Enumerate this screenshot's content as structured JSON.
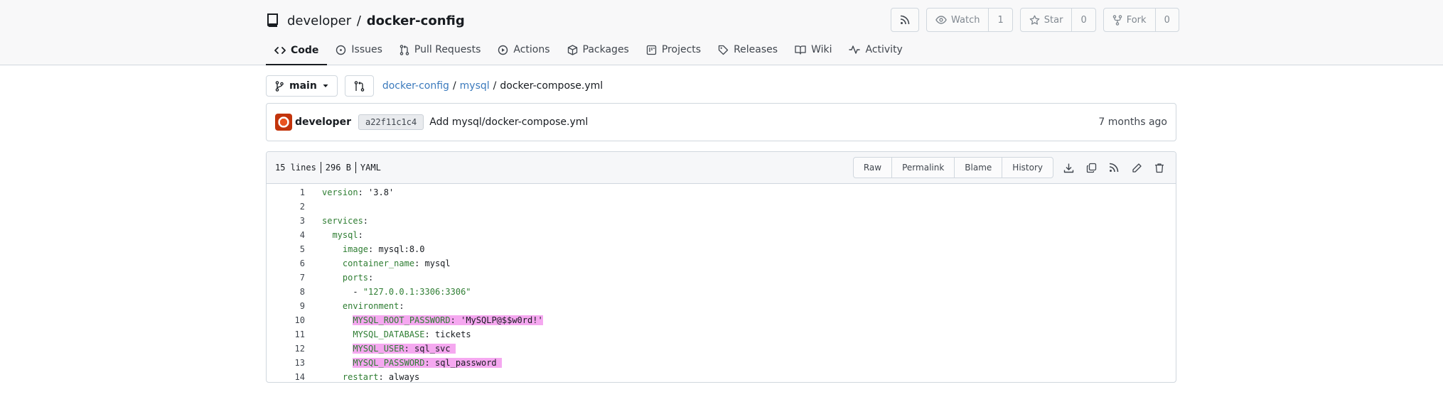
{
  "repo": {
    "owner": "developer",
    "separator": "/",
    "name": "docker-config"
  },
  "header_actions": {
    "rss_label": "",
    "watch": {
      "label": "Watch",
      "count": "1"
    },
    "star": {
      "label": "Star",
      "count": "0"
    },
    "fork": {
      "label": "Fork",
      "count": "0"
    }
  },
  "tabs": [
    {
      "label": "Code",
      "icon": "code-icon",
      "active": true
    },
    {
      "label": "Issues",
      "icon": "issue-icon"
    },
    {
      "label": "Pull Requests",
      "icon": "pull-request-icon"
    },
    {
      "label": "Actions",
      "icon": "play-icon"
    },
    {
      "label": "Packages",
      "icon": "package-icon"
    },
    {
      "label": "Projects",
      "icon": "project-icon"
    },
    {
      "label": "Releases",
      "icon": "tag-icon"
    },
    {
      "label": "Wiki",
      "icon": "book-icon"
    },
    {
      "label": "Activity",
      "icon": "pulse-icon"
    }
  ],
  "branch": {
    "name": "main"
  },
  "breadcrumb": {
    "root": "docker-config",
    "dir": "mysql",
    "file": "docker-compose.yml"
  },
  "commit": {
    "author": "developer",
    "sha": "a22f11c1c4",
    "message": "Add mysql/docker-compose.yml",
    "time": "7 months ago"
  },
  "file": {
    "lines": "15 lines",
    "size": "296 B",
    "type": "YAML",
    "actions": [
      "Raw",
      "Permalink",
      "Blame",
      "History"
    ]
  },
  "code": {
    "l1": {
      "n": "1",
      "key": "version",
      "rest": ": '3.8'"
    },
    "l2": {
      "n": "2"
    },
    "l3": {
      "n": "3",
      "key": "services",
      "rest": ":"
    },
    "l4": {
      "n": "4",
      "indent": "  ",
      "key": "mysql",
      "rest": ":"
    },
    "l5": {
      "n": "5",
      "indent": "    ",
      "key": "image",
      "rest": ": mysql:8.0"
    },
    "l6": {
      "n": "6",
      "indent": "    ",
      "key": "container_name",
      "rest": ": mysql"
    },
    "l7": {
      "n": "7",
      "indent": "    ",
      "key": "ports",
      "rest": ":"
    },
    "l8": {
      "n": "8",
      "indent": "      ",
      "dash": "- ",
      "str": "\"127.0.0.1:3306:3306\""
    },
    "l9": {
      "n": "9",
      "indent": "    ",
      "key": "environment",
      "rest": ":"
    },
    "l10": {
      "n": "10",
      "indent": "      ",
      "key": "MYSQL_ROOT_PASSWORD",
      "rest": ": 'MySQLP@$$w0rd!'"
    },
    "l11": {
      "n": "11",
      "indent": "      ",
      "key": "MYSQL_DATABASE",
      "rest": ": tickets"
    },
    "l12": {
      "n": "12",
      "indent": "      ",
      "key": "MYSQL_USER",
      "rest": ": sql_svc "
    },
    "l13": {
      "n": "13",
      "indent": "      ",
      "key": "MYSQL_PASSWORD",
      "rest": ": sql_password "
    },
    "l14": {
      "n": "14",
      "indent": "    ",
      "key": "restart",
      "rest": ": always"
    }
  }
}
